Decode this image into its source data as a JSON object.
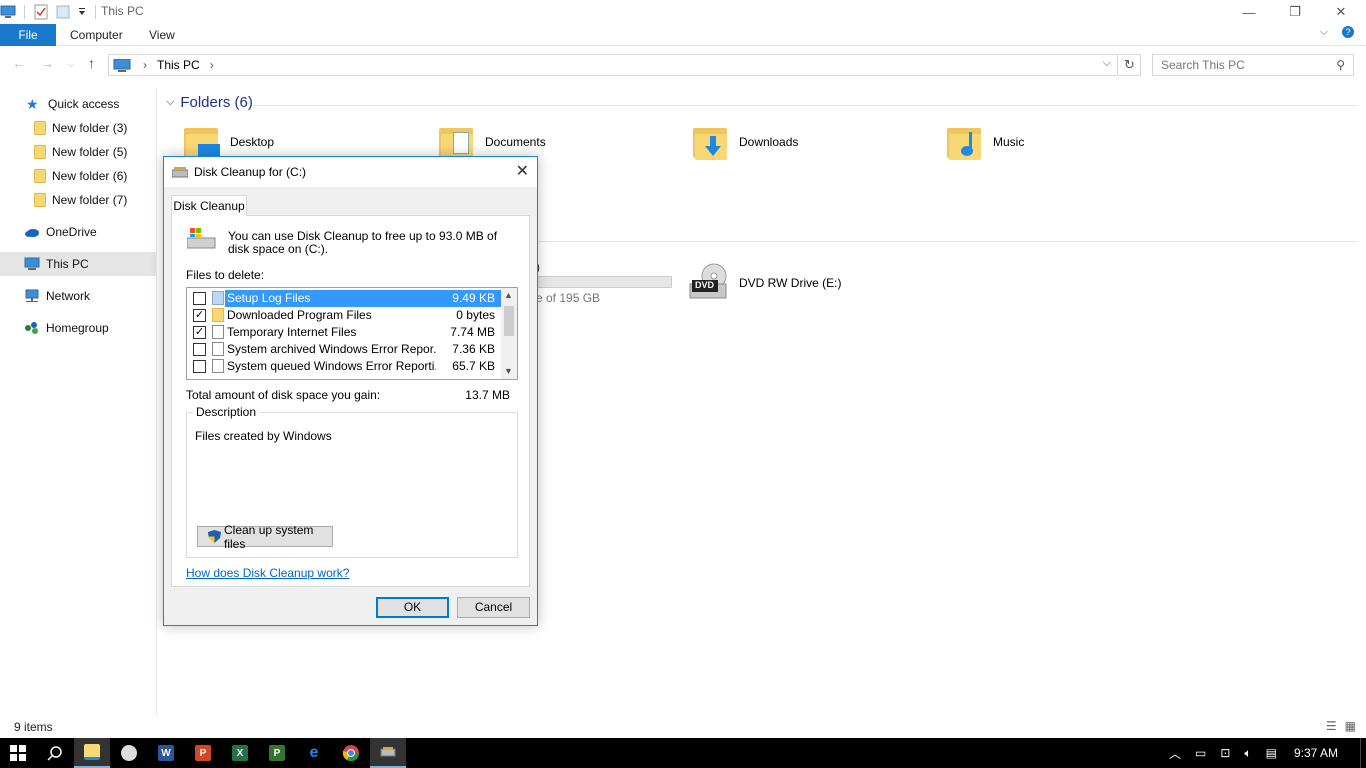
{
  "window": {
    "title": "This PC",
    "controls": {
      "minimize": "—",
      "restore": "❐",
      "close": "✕"
    }
  },
  "ribbon": {
    "tabs": [
      "File",
      "Computer",
      "View"
    ],
    "expand_icon": "chevron-down-icon",
    "help_icon": "help-icon"
  },
  "address": {
    "crumbs": [
      "This PC"
    ],
    "separator": "›",
    "search_placeholder": "Search This PC"
  },
  "sidebar": {
    "items": [
      {
        "label": "Quick access",
        "icon": "star-icon"
      },
      {
        "label": "New folder (3)",
        "icon": "folder-icon"
      },
      {
        "label": "New folder (5)",
        "icon": "folder-icon"
      },
      {
        "label": "New folder (6)",
        "icon": "folder-icon"
      },
      {
        "label": "New folder (7)",
        "icon": "folder-icon"
      },
      {
        "label": "OneDrive",
        "icon": "cloud-icon"
      },
      {
        "label": "This PC",
        "icon": "computer-icon",
        "selected": true
      },
      {
        "label": "Network",
        "icon": "network-icon"
      },
      {
        "label": "Homegroup",
        "icon": "homegroup-icon"
      }
    ]
  },
  "main": {
    "folders_header": "Folders (6)",
    "folders": [
      "Desktop",
      "Documents",
      "Downloads",
      "Music"
    ],
    "drive_partial_label": ")",
    "drive_partial_free": "e of 195 GB",
    "drive_fill_fraction": 0.0,
    "dvd_drive": "DVD RW Drive (E:)",
    "dvd_badge": "DVD"
  },
  "status": {
    "items_count": "9 items"
  },
  "dialog": {
    "title": "Disk Cleanup for  (C:)",
    "tab": "Disk Cleanup",
    "intro": "You can use Disk Cleanup to free up to 93.0 MB of disk space on  (C:).",
    "files_label": "Files to delete:",
    "files": [
      {
        "name": "Setup Log Files",
        "size": "9.49 KB",
        "checked": false,
        "selected": true
      },
      {
        "name": "Downloaded Program Files",
        "size": "0 bytes",
        "checked": true,
        "selected": false
      },
      {
        "name": "Temporary Internet Files",
        "size": "7.74 MB",
        "checked": true,
        "selected": false
      },
      {
        "name": "System archived Windows Error Repor...",
        "size": "7.36 KB",
        "checked": false,
        "selected": false
      },
      {
        "name": "System queued Windows Error Reporti...",
        "size": "65.7 KB",
        "checked": false,
        "selected": false
      }
    ],
    "total_label": "Total amount of disk space you gain:",
    "total_value": "13.7 MB",
    "description_label": "Description",
    "description_text": "Files created by Windows",
    "cleanup_button": "Clean up system files",
    "help_link": "How does Disk Cleanup work?",
    "ok": "OK",
    "cancel": "Cancel"
  },
  "taskbar": {
    "time": "9:37 AM",
    "apps": [
      "start",
      "search",
      "file-explorer",
      "paint",
      "word",
      "powerpoint",
      "excel",
      "project",
      "edge",
      "chrome",
      "disk-cleanup"
    ]
  },
  "colors": {
    "accent": "#1979ca",
    "selection": "#3399ff",
    "folder": "#f8d775",
    "link": "#0066cc",
    "group_header": "#1e3287"
  }
}
